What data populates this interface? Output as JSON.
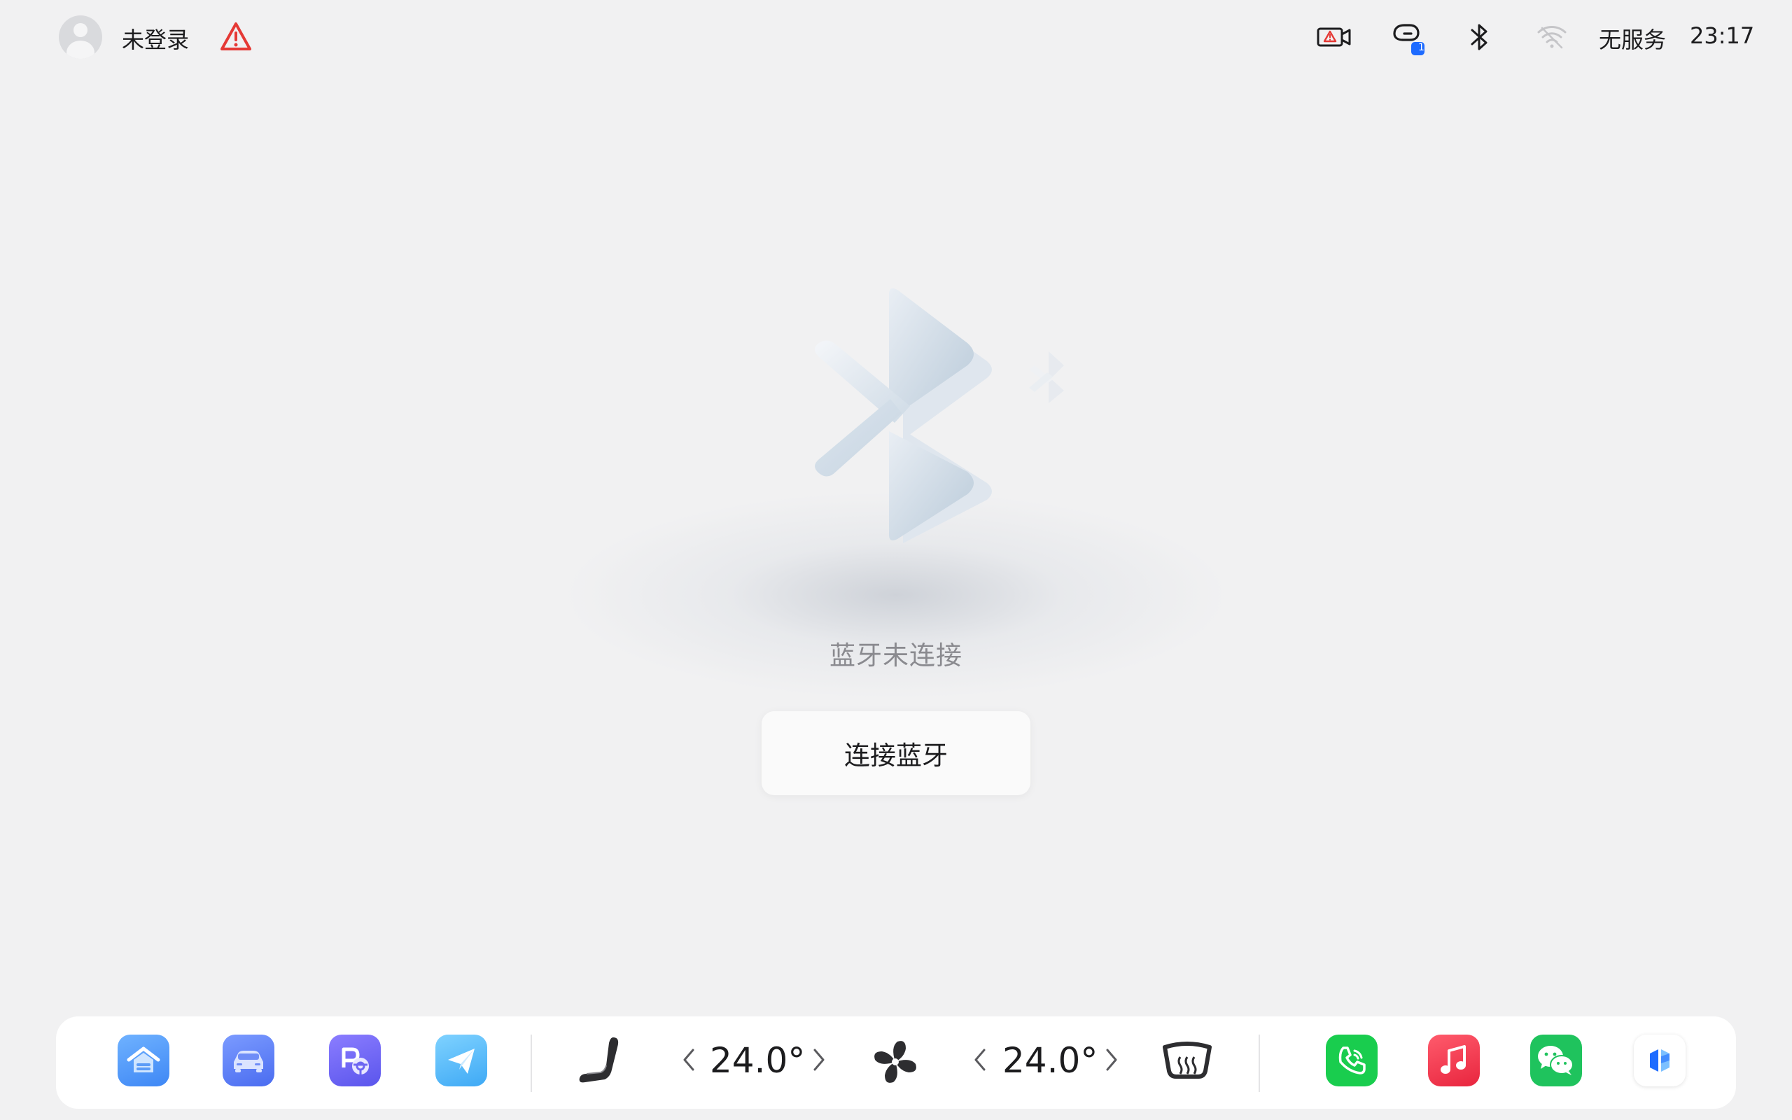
{
  "statusbar": {
    "login_label": "未登录",
    "network_label": "无服务",
    "time": "23:17",
    "notification_badge": "1"
  },
  "main": {
    "bluetooth_status": "蓝牙未连接",
    "connect_button_label": "连接蓝牙"
  },
  "dock": {
    "left_temp": "24.0°",
    "right_temp": "24.0°",
    "apps_left": [
      "home-app",
      "car-app",
      "parking-app",
      "navigation-app"
    ],
    "apps_right": [
      "phone-app",
      "music-app",
      "wechat-app",
      "assistant-app"
    ]
  },
  "colors": {
    "background": "#f1f1f2",
    "warning_red": "#e53935",
    "badge_blue": "#1e6bff",
    "phone_green": "#19cd4e",
    "music_red": "#f2384c",
    "wechat_green": "#1fc35d"
  }
}
